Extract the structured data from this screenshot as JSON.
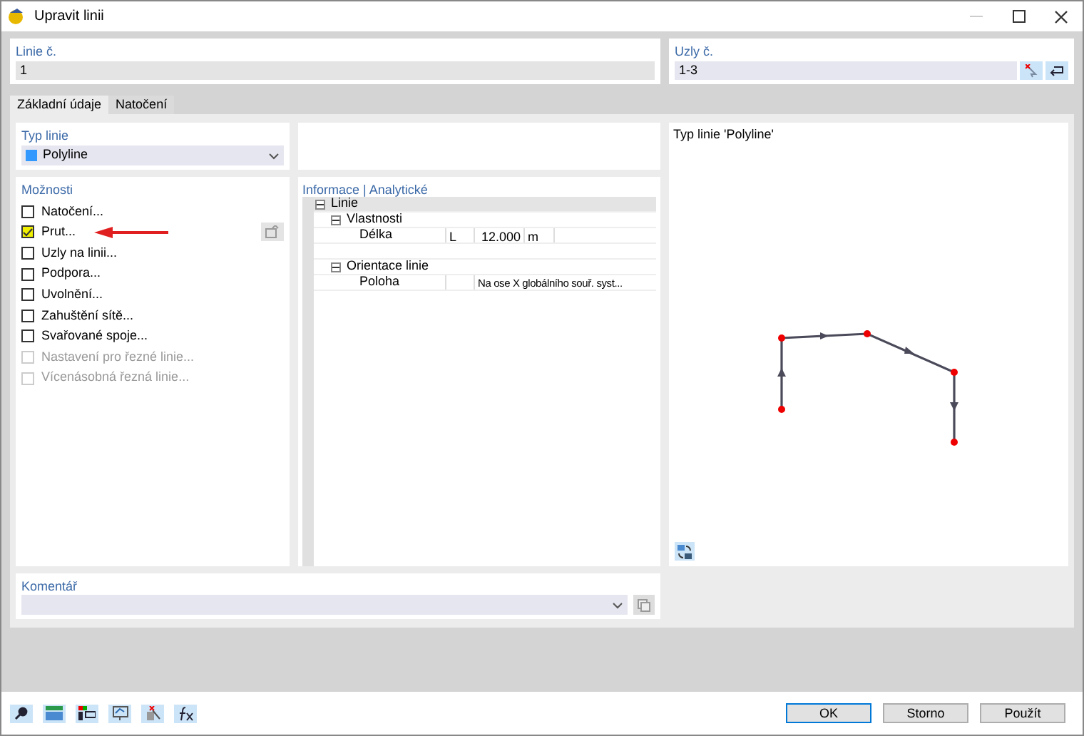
{
  "window": {
    "title": "Upravit linii"
  },
  "line_no": {
    "label": "Linie č.",
    "value": "1"
  },
  "nodes_no": {
    "label": "Uzly č.",
    "value": "1-3"
  },
  "tabs": [
    {
      "label": "Základní údaje",
      "selected": true
    },
    {
      "label": "Natočení",
      "selected": false
    }
  ],
  "line_type": {
    "label": "Typ linie",
    "value": "Polyline",
    "color": "#3399ff"
  },
  "options": {
    "title": "Možnosti",
    "items": [
      {
        "label": "Natočení...",
        "checked": false,
        "disabled": false
      },
      {
        "label": "Prut...",
        "checked": true,
        "disabled": false
      },
      {
        "label": "Uzly na linii...",
        "checked": false,
        "disabled": false
      },
      {
        "label": "Podpora...",
        "checked": false,
        "disabled": false
      },
      {
        "label": "Uvolnění...",
        "checked": false,
        "disabled": false
      },
      {
        "label": "Zahuštění sítě...",
        "checked": false,
        "disabled": false
      },
      {
        "label": "Svařované spoje...",
        "checked": false,
        "disabled": false
      },
      {
        "label": "Nastavení pro řezné linie...",
        "checked": false,
        "disabled": true
      },
      {
        "label": "Vícenásobná řezná linie...",
        "checked": false,
        "disabled": true
      }
    ]
  },
  "info": {
    "title": "Informace | Analytické",
    "tree": [
      {
        "label": "Linie",
        "expanded": true,
        "children": [
          {
            "label": "Vlastnosti",
            "expanded": true,
            "children": [
              {
                "label": "Délka",
                "symbol": "L",
                "value": "12.000",
                "unit": "m"
              }
            ]
          },
          {
            "label": "Orientace linie",
            "expanded": true,
            "children": [
              {
                "label": "Poloha",
                "value": "Na ose X globálního souř. syst..."
              }
            ]
          }
        ]
      }
    ]
  },
  "preview": {
    "title": "Typ linie 'Polyline'"
  },
  "comment": {
    "label": "Komentář"
  },
  "buttons": [
    {
      "label": "OK",
      "default": true
    },
    {
      "label": "Storno",
      "default": false
    },
    {
      "label": "Použít",
      "default": false
    }
  ]
}
